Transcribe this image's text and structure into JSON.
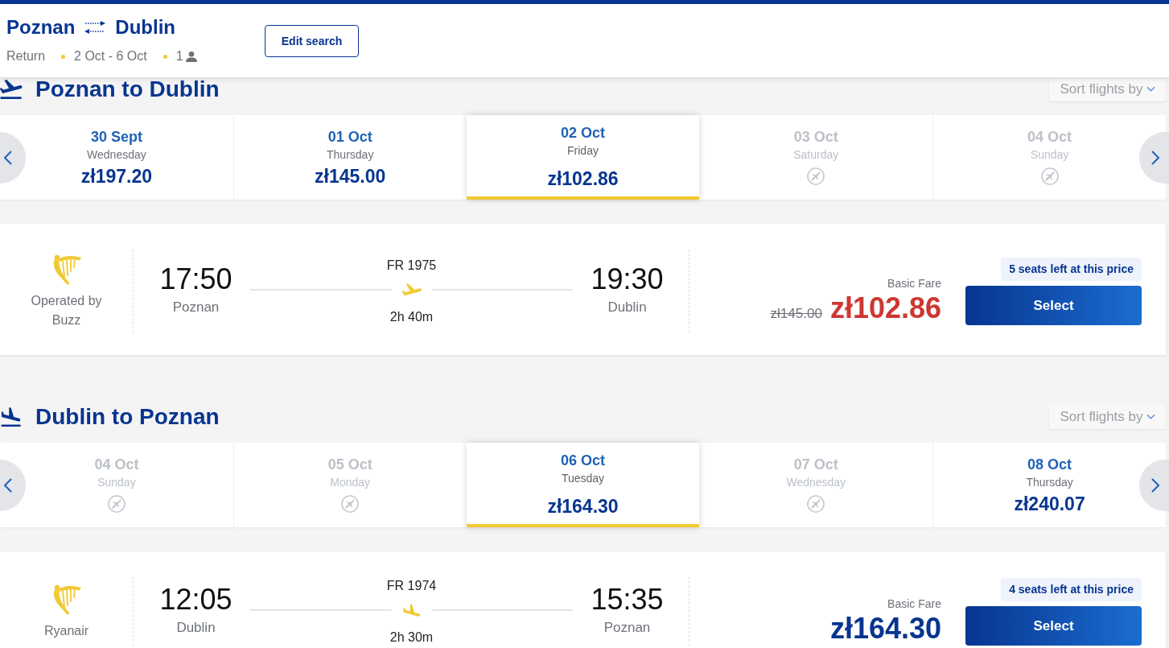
{
  "header": {
    "origin": "Poznan",
    "destination": "Dublin",
    "trip_type": "Return",
    "dates": "2 Oct - 6 Oct",
    "passengers": "1",
    "edit_button": "Edit search"
  },
  "sections": [
    {
      "kind": "outbound",
      "title": "Poznan to Dublin",
      "sort_label": "Sort flights by",
      "dates": [
        {
          "date": "30 Sept",
          "weekday": "Wednesday",
          "price": "zł197.20",
          "available": true,
          "selected": false
        },
        {
          "date": "01 Oct",
          "weekday": "Thursday",
          "price": "zł145.00",
          "available": true,
          "selected": false
        },
        {
          "date": "02 Oct",
          "weekday": "Friday",
          "price": "zł102.86",
          "available": true,
          "selected": true
        },
        {
          "date": "03 Oct",
          "weekday": "Saturday",
          "available": false,
          "selected": false
        },
        {
          "date": "04 Oct",
          "weekday": "Sunday",
          "available": false,
          "selected": false
        }
      ],
      "flight": {
        "operator": "Operated by Buzz",
        "departure_time": "17:50",
        "departure_city": "Poznan",
        "flight_number": "FR 1975",
        "duration": "2h 40m",
        "arrival_time": "19:30",
        "arrival_city": "Dublin",
        "fare_label": "Basic Fare",
        "old_price": "zł145.00",
        "price": "zł102.86",
        "discounted": true,
        "seats_left": "5 seats left at this price",
        "select_button": "Select"
      }
    },
    {
      "kind": "return",
      "title": "Dublin to Poznan",
      "sort_label": "Sort flights by",
      "dates": [
        {
          "date": "04 Oct",
          "weekday": "Sunday",
          "available": false,
          "selected": false
        },
        {
          "date": "05 Oct",
          "weekday": "Monday",
          "available": false,
          "selected": false
        },
        {
          "date": "06 Oct",
          "weekday": "Tuesday",
          "price": "zł164.30",
          "available": true,
          "selected": true
        },
        {
          "date": "07 Oct",
          "weekday": "Wednesday",
          "available": false,
          "selected": false
        },
        {
          "date": "08 Oct",
          "weekday": "Thursday",
          "price": "zł240.07",
          "available": true,
          "selected": false
        }
      ],
      "flight": {
        "operator": "Ryanair",
        "departure_time": "12:05",
        "departure_city": "Dublin",
        "flight_number": "FR 1974",
        "duration": "2h 30m",
        "arrival_time": "15:35",
        "arrival_city": "Poznan",
        "fare_label": "Basic Fare",
        "price": "zł164.30",
        "discounted": false,
        "seats_left": "4 seats left at this price",
        "select_button": "Select"
      }
    }
  ]
}
